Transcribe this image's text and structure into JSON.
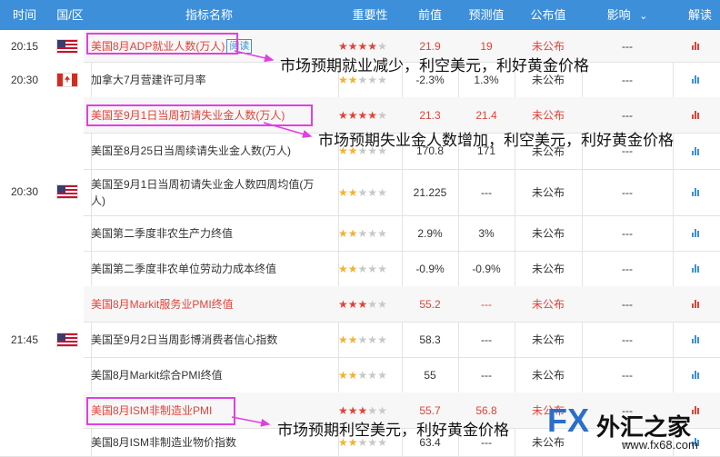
{
  "header": {
    "time": "时间",
    "region": "国/区",
    "name": "指标名称",
    "importance": "重要性",
    "previous": "前值",
    "forecast": "预测值",
    "published": "公布值",
    "effect": "影响",
    "explain": "解读"
  },
  "groups": [
    {
      "time": "20:15",
      "flag": "us-flag"
    },
    {
      "time": "20:30",
      "flag": "ca-flag"
    },
    {
      "time": "20:30",
      "flag": "us-flag"
    },
    {
      "time": "21:45",
      "flag": "us-flag"
    },
    {
      "time": "",
      "flag": ""
    }
  ],
  "rows": [
    {
      "name": "美国8月ADP就业人数(万人)",
      "badge": "阅读",
      "stars": 4,
      "prev": "21.9",
      "fore": "19",
      "pub": "未公布",
      "effect": "---",
      "red": true
    },
    {
      "name": "加拿大7月营建许可月率",
      "stars": 2,
      "prev": "-2.3%",
      "fore": "1.3%",
      "pub": "未公布",
      "effect": "---",
      "red": false
    },
    {
      "name": "美国至9月1日当周初请失业金人数(万人)",
      "stars": 4,
      "prev": "21.3",
      "fore": "21.4",
      "pub": "未公布",
      "effect": "---",
      "red": true
    },
    {
      "name": "美国至8月25日当周续请失业金人数(万人)",
      "stars": 2,
      "prev": "170.8",
      "fore": "171",
      "pub": "未公布",
      "effect": "---",
      "red": false
    },
    {
      "name": "美国至9月1日当周初请失业金人数四周均值(万人)",
      "stars": 2,
      "prev": "21.225",
      "fore": "---",
      "pub": "未公布",
      "effect": "---",
      "red": false
    },
    {
      "name": "美国第二季度非农生产力终值",
      "stars": 2,
      "prev": "2.9%",
      "fore": "3%",
      "pub": "未公布",
      "effect": "---",
      "red": false
    },
    {
      "name": "美国第二季度非农单位劳动力成本终值",
      "stars": 2,
      "prev": "-0.9%",
      "fore": "-0.9%",
      "pub": "未公布",
      "effect": "---",
      "red": false
    },
    {
      "name": "美国8月Markit服务业PMI终值",
      "stars": 3,
      "prev": "55.2",
      "fore": "---",
      "pub": "未公布",
      "effect": "---",
      "red": true
    },
    {
      "name": "美国至9月2日当周彭博消费者信心指数",
      "stars": 2,
      "prev": "58.3",
      "fore": "---",
      "pub": "未公布",
      "effect": "---",
      "red": false
    },
    {
      "name": "美国8月Markit综合PMI终值",
      "stars": 2,
      "prev": "55",
      "fore": "---",
      "pub": "未公布",
      "effect": "---",
      "red": false
    },
    {
      "name": "美国8月ISM非制造业PMI",
      "stars": 3,
      "prev": "55.7",
      "fore": "56.8",
      "pub": "未公布",
      "effect": "---",
      "red": true
    },
    {
      "name": "美国8月ISM非制造业物价指数",
      "stars": 2,
      "prev": "63.4",
      "fore": "---",
      "pub": "未公布",
      "effect": "---",
      "red": false
    }
  ],
  "annotations": [
    "市场预期就业减少，利空美元，利好黄金价格",
    "市场预期失业金人数增加，利空美元，利好黄金价格",
    "市场预期利空美元，利好黄金价格"
  ],
  "watermark": {
    "fx": "FX",
    "cn": "外汇之家",
    "url": "www.fx68.com"
  },
  "colors": {
    "header": "#3d8fd9",
    "red": "#e0433a",
    "star": "#f2b233",
    "box": "#e040e0"
  }
}
